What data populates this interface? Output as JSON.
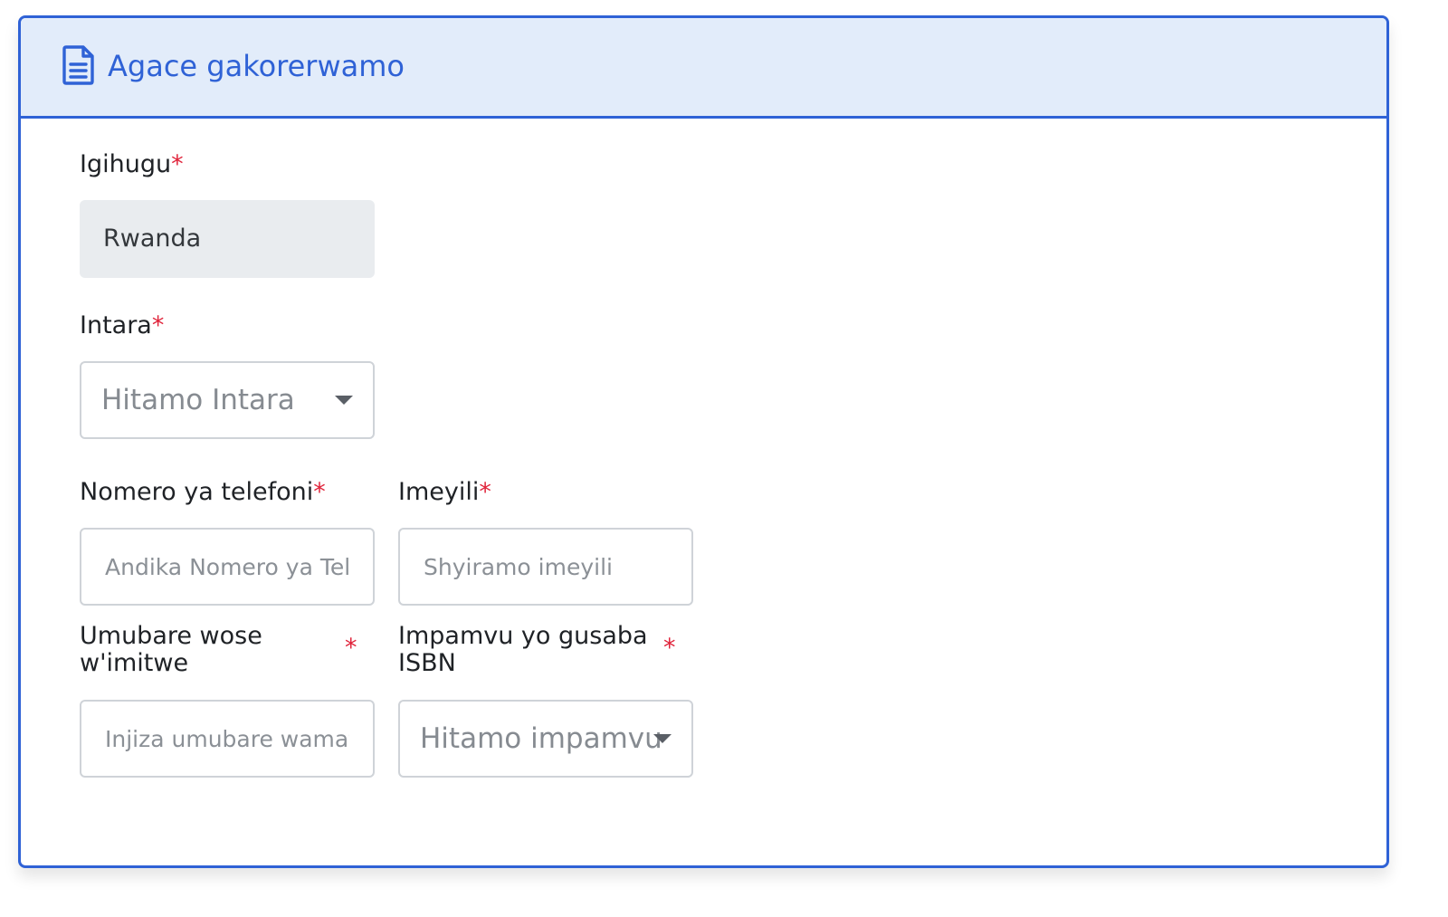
{
  "section": {
    "title": "Agace gakorerwamo",
    "icon": "document-icon",
    "accent_color": "#2f62d6",
    "header_bg": "#e2ecfa"
  },
  "required_marker": "*",
  "fields": {
    "country": {
      "label": "Igihugu",
      "value": "Rwanda"
    },
    "province": {
      "label": "Intara",
      "placeholder": "Hitamo Intara"
    },
    "phone": {
      "label": "Nomero ya telefoni",
      "placeholder": "Andika Nomero ya Telefoni"
    },
    "email": {
      "label": "Imeyili",
      "placeholder": "Shyiramo imeyili"
    },
    "titles_count": {
      "label": "Umubare wose w'imitwe",
      "placeholder": "Injiza umubare wamatwe"
    },
    "isbn_reason": {
      "label": "Impamvu yo gusaba ISBN",
      "placeholder": "Hitamo impamvu"
    }
  }
}
